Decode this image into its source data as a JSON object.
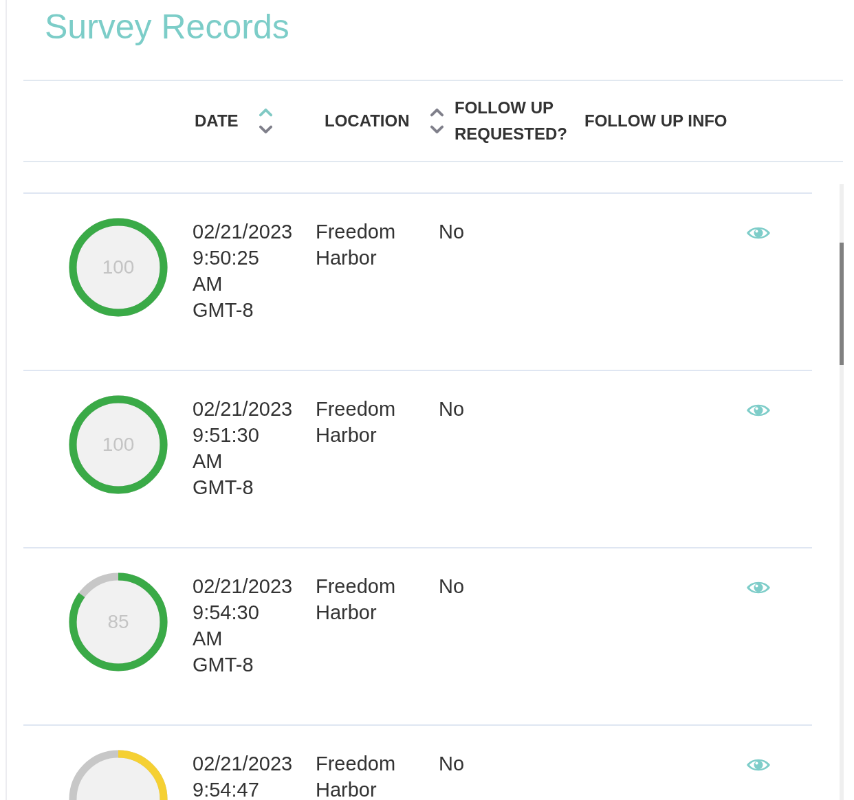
{
  "page": {
    "title": "Survey Records"
  },
  "table": {
    "columns": [
      {
        "label": "DATE",
        "sortable": true,
        "sorted": true
      },
      {
        "label": "LOCATION",
        "sortable": true,
        "sorted": false
      },
      {
        "label": "FOLLOW UP REQUESTED?",
        "sortable": false
      },
      {
        "label": "FOLLOW UP INFO",
        "sortable": false
      }
    ],
    "rows": [
      {
        "score": "100",
        "level": 1.0,
        "color": "#3aaa47",
        "date": [
          "02/21/2023",
          "9:50:25",
          "AM",
          "GMT-8"
        ],
        "location": [
          "Freedom",
          "Harbor"
        ],
        "follow_up": "No"
      },
      {
        "score": "100",
        "level": 1.0,
        "color": "#3aaa47",
        "date": [
          "02/21/2023",
          "9:51:30",
          "AM",
          "GMT-8"
        ],
        "location": [
          "Freedom",
          "Harbor"
        ],
        "follow_up": "No"
      },
      {
        "score": "85",
        "level": 0.85,
        "color": "#3aaa47",
        "date": [
          "02/21/2023",
          "9:54:30",
          "AM",
          "GMT-8"
        ],
        "location": [
          "Freedom",
          "Harbor"
        ],
        "follow_up": "No"
      },
      {
        "color": "#f5d033",
        "date": [
          "02/21/2023",
          "9:54:47"
        ],
        "location": [
          "Freedom",
          "Harbor"
        ],
        "follow_up": "No"
      }
    ]
  }
}
